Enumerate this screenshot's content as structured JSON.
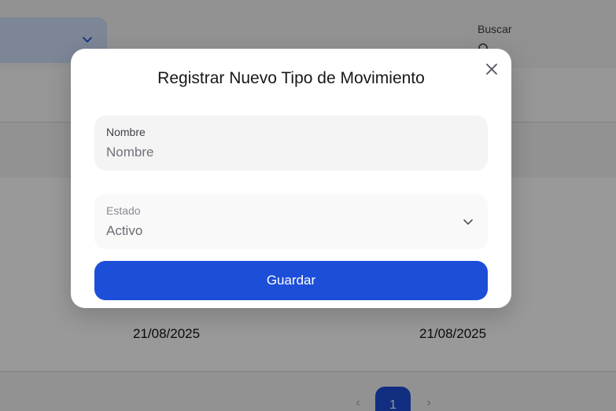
{
  "background": {
    "search_label": "Buscar",
    "dates": [
      "21/08/2025",
      "21/08/2025"
    ],
    "pagination": {
      "current_page": "1",
      "prev_icon": "chevron-left-icon",
      "next_icon": "chevron-right-icon"
    }
  },
  "modal": {
    "title": "Registrar Nuevo Tipo de Movimiento",
    "close_icon": "close-icon",
    "name_field": {
      "label": "Nombre",
      "placeholder": "Nombre",
      "value": ""
    },
    "status_field": {
      "label": "Estado",
      "value": "Activo"
    },
    "save_label": "Guardar"
  },
  "colors": {
    "accent": "#1d4ed8",
    "overlay": "rgba(0,0,0,0.40)"
  }
}
